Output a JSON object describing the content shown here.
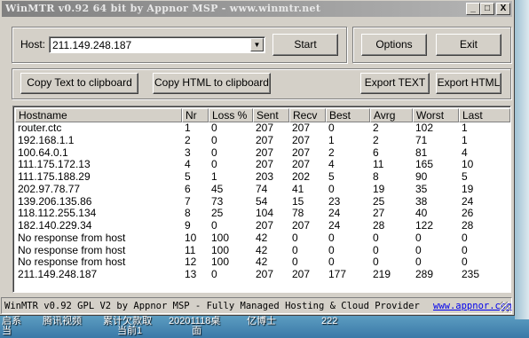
{
  "window": {
    "title": "WinMTR v0.92 64 bit by Appnor MSP - www.winmtr.net",
    "minimize_glyph": "_",
    "maximize_glyph": "□",
    "close_glyph": "X"
  },
  "controls": {
    "host_label": "Host:",
    "host_value": "211.149.248.187",
    "start_label": "Start",
    "options_label": "Options",
    "exit_label": "Exit",
    "copy_text_label": "Copy Text to clipboard",
    "copy_html_label": "Copy HTML to clipboard",
    "export_text_label": "Export TEXT",
    "export_html_label": "Export HTML"
  },
  "table": {
    "columns": [
      "Hostname",
      "Nr",
      "Loss %",
      "Sent",
      "Recv",
      "Best",
      "Avrg",
      "Worst",
      "Last"
    ],
    "rows": [
      [
        "router.ctc",
        "1",
        "0",
        "207",
        "207",
        "0",
        "2",
        "102",
        "1"
      ],
      [
        "192.168.1.1",
        "2",
        "0",
        "207",
        "207",
        "1",
        "2",
        "71",
        "1"
      ],
      [
        "100.64.0.1",
        "3",
        "0",
        "207",
        "207",
        "2",
        "6",
        "81",
        "4"
      ],
      [
        "111.175.172.13",
        "4",
        "0",
        "207",
        "207",
        "4",
        "11",
        "165",
        "10"
      ],
      [
        "111.175.188.29",
        "5",
        "1",
        "203",
        "202",
        "5",
        "8",
        "90",
        "5"
      ],
      [
        "202.97.78.77",
        "6",
        "45",
        "74",
        "41",
        "0",
        "19",
        "35",
        "19"
      ],
      [
        "139.206.135.86",
        "7",
        "73",
        "54",
        "15",
        "23",
        "25",
        "38",
        "24"
      ],
      [
        "118.112.255.134",
        "8",
        "25",
        "104",
        "78",
        "24",
        "27",
        "40",
        "26"
      ],
      [
        "182.140.229.34",
        "9",
        "0",
        "207",
        "207",
        "24",
        "28",
        "122",
        "28"
      ],
      [
        "No response from host",
        "10",
        "100",
        "42",
        "0",
        "0",
        "0",
        "0",
        "0"
      ],
      [
        "No response from host",
        "11",
        "100",
        "42",
        "0",
        "0",
        "0",
        "0",
        "0"
      ],
      [
        "No response from host",
        "12",
        "100",
        "42",
        "0",
        "0",
        "0",
        "0",
        "0"
      ],
      [
        "211.149.248.187",
        "13",
        "0",
        "207",
        "207",
        "177",
        "219",
        "289",
        "235"
      ]
    ]
  },
  "statusbar": {
    "text": "WinMTR v0.92 GPL V2 by Appnor MSP - Fully Managed Hosting & Cloud Provider",
    "link": "www.appnor.com"
  },
  "desktop": {
    "labels": [
      "腾讯视频",
      "累计欠款取",
      "20201118桌",
      "亿博士",
      "222"
    ],
    "labels_line2": [
      "",
      "当前1",
      "面",
      "",
      ""
    ],
    "left_fragment": "启系",
    "left_fragment2": "当"
  }
}
